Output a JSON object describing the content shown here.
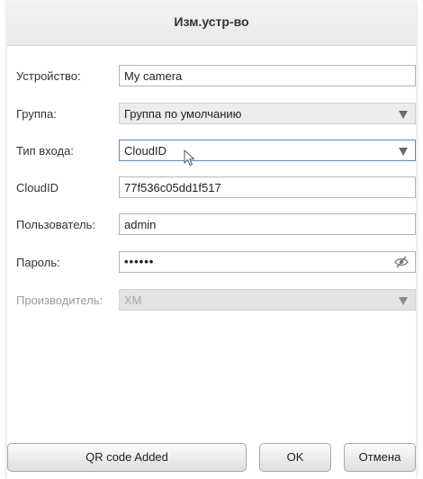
{
  "dialog": {
    "title": "Изм.устр-во"
  },
  "form": {
    "device_label": "Устройство:",
    "device_value": "My camera",
    "group_label": "Группа:",
    "group_value": "Группа по умолчанию",
    "login_type_label": "Тип входа:",
    "login_type_value": "CloudID",
    "cloudid_label": "CloudID",
    "cloudid_value": "77f536c05dd1f517",
    "user_label": "Пользователь:",
    "user_value": "admin",
    "password_label": "Пароль:",
    "password_value": "••••••",
    "manufacturer_label": "Производитель:",
    "manufacturer_value": "XM"
  },
  "buttons": {
    "qr_label": "QR code Added",
    "ok_label": "OK",
    "cancel_label": "Отмена"
  },
  "icons": {
    "dropdown": "triangle-down-icon",
    "password_toggle": "eye-slash-icon",
    "cursor": "mouse-pointer-icon"
  },
  "colors": {
    "focus_border": "#4a90d9",
    "disabled_text": "#a8a8a8"
  }
}
